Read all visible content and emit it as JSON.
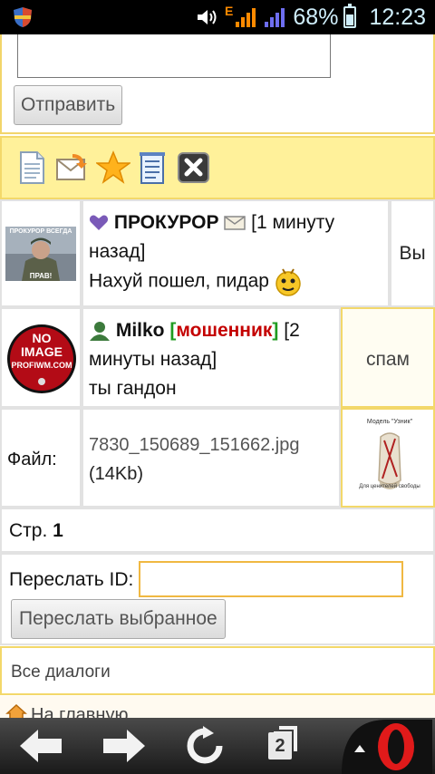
{
  "status_bar": {
    "battery_percent": "68%",
    "time": "12:23",
    "network_type": "E",
    "battery_level": 0.68
  },
  "compose": {
    "send_label": "Отправить"
  },
  "toolbar": {
    "icons": [
      "document-icon",
      "mail-forward-icon",
      "star-icon",
      "notepad-icon",
      "delete-icon"
    ]
  },
  "messages": [
    {
      "avatar_caption_top": "ПРОКУРОР ВСЕГДА",
      "avatar_caption_bottom": "ПРАВ!",
      "nick": "ПРОКУРОР",
      "time_text": "[1 минуту назад]",
      "text": "Нахуй пошел, пидар",
      "side": "Вы"
    },
    {
      "avatar_lines": [
        "NO",
        "IMAGE",
        "PROFIWM.COM"
      ],
      "nick": "Milko",
      "tag_open": "[",
      "tag": "мошенник",
      "tag_close": "]",
      "time_text": "[2 минуты назад]",
      "text": "ты гандон",
      "side": "спам"
    }
  ],
  "file": {
    "label": "Файл:",
    "name": "7830_150689_151662.jpg",
    "size": "(14Kb)",
    "thumb_title": "Модель \"Узник\"",
    "thumb_caption": "Для ценителей свободы"
  },
  "pagination": {
    "label": "Стр.",
    "current": "1"
  },
  "forward": {
    "label": "Переслать ID:",
    "input_value": "",
    "button_label": "Переслать выбранное"
  },
  "links": {
    "all_dialogs": "Все диалоги",
    "home": "На главную"
  },
  "browser_nav": {
    "tabs_count": "2"
  }
}
